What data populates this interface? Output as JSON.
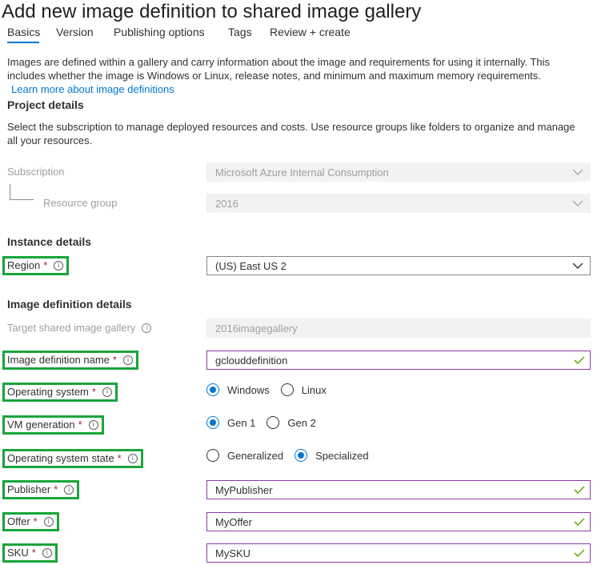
{
  "page": {
    "title": "Add new image definition to shared image gallery"
  },
  "tabs": [
    {
      "label": "Basics",
      "active": true
    },
    {
      "label": "Version"
    },
    {
      "label": "Publishing options"
    },
    {
      "label": "Tags"
    },
    {
      "label": "Review + create"
    }
  ],
  "intro": {
    "text": "Images are defined within a gallery and carry information about the image and requirements for using it internally. This includes whether the image is Windows or Linux, release notes, and minimum and maximum memory requirements.",
    "link": "Learn more about image definitions"
  },
  "project": {
    "heading": "Project details",
    "description": "Select the subscription to manage deployed resources and costs. Use resource groups like folders to organize and manage all your resources.",
    "subscription_label": "Subscription",
    "subscription_value": "Microsoft Azure Internal Consumption",
    "resource_group_label": "Resource group",
    "resource_group_value": "2016"
  },
  "instance": {
    "heading": "Instance details",
    "region_label": "Region",
    "region_value": "(US) East US 2"
  },
  "image_def": {
    "heading": "Image definition details",
    "gallery_label": "Target shared image gallery",
    "gallery_value": "2016imagegallery",
    "name_label": "Image definition name",
    "name_value": "gclouddefinition",
    "os_label": "Operating system",
    "os_options": [
      "Windows",
      "Linux"
    ],
    "os_selected": "Windows",
    "vmgen_label": "VM generation",
    "vmgen_options": [
      "Gen 1",
      "Gen 2"
    ],
    "vmgen_selected": "Gen 1",
    "osstate_label": "Operating system state",
    "osstate_options": [
      "Generalized",
      "Specialized"
    ],
    "osstate_selected": "Specialized",
    "publisher_label": "Publisher",
    "publisher_value": "MyPublisher",
    "offer_label": "Offer",
    "offer_value": "MyOffer",
    "sku_label": "SKU",
    "sku_value": "MySKU"
  },
  "common": {
    "required_mark": "*",
    "info_glyph": "i"
  },
  "colors": {
    "accent": "#0078d4",
    "highlight": "#1aa53a",
    "valid": "#57a300",
    "required": "#a4262c",
    "field_border": "#8a3ca8"
  },
  "icons": {
    "info": "info-icon",
    "chevron": "chevron-down-icon",
    "check": "checkmark-icon"
  }
}
